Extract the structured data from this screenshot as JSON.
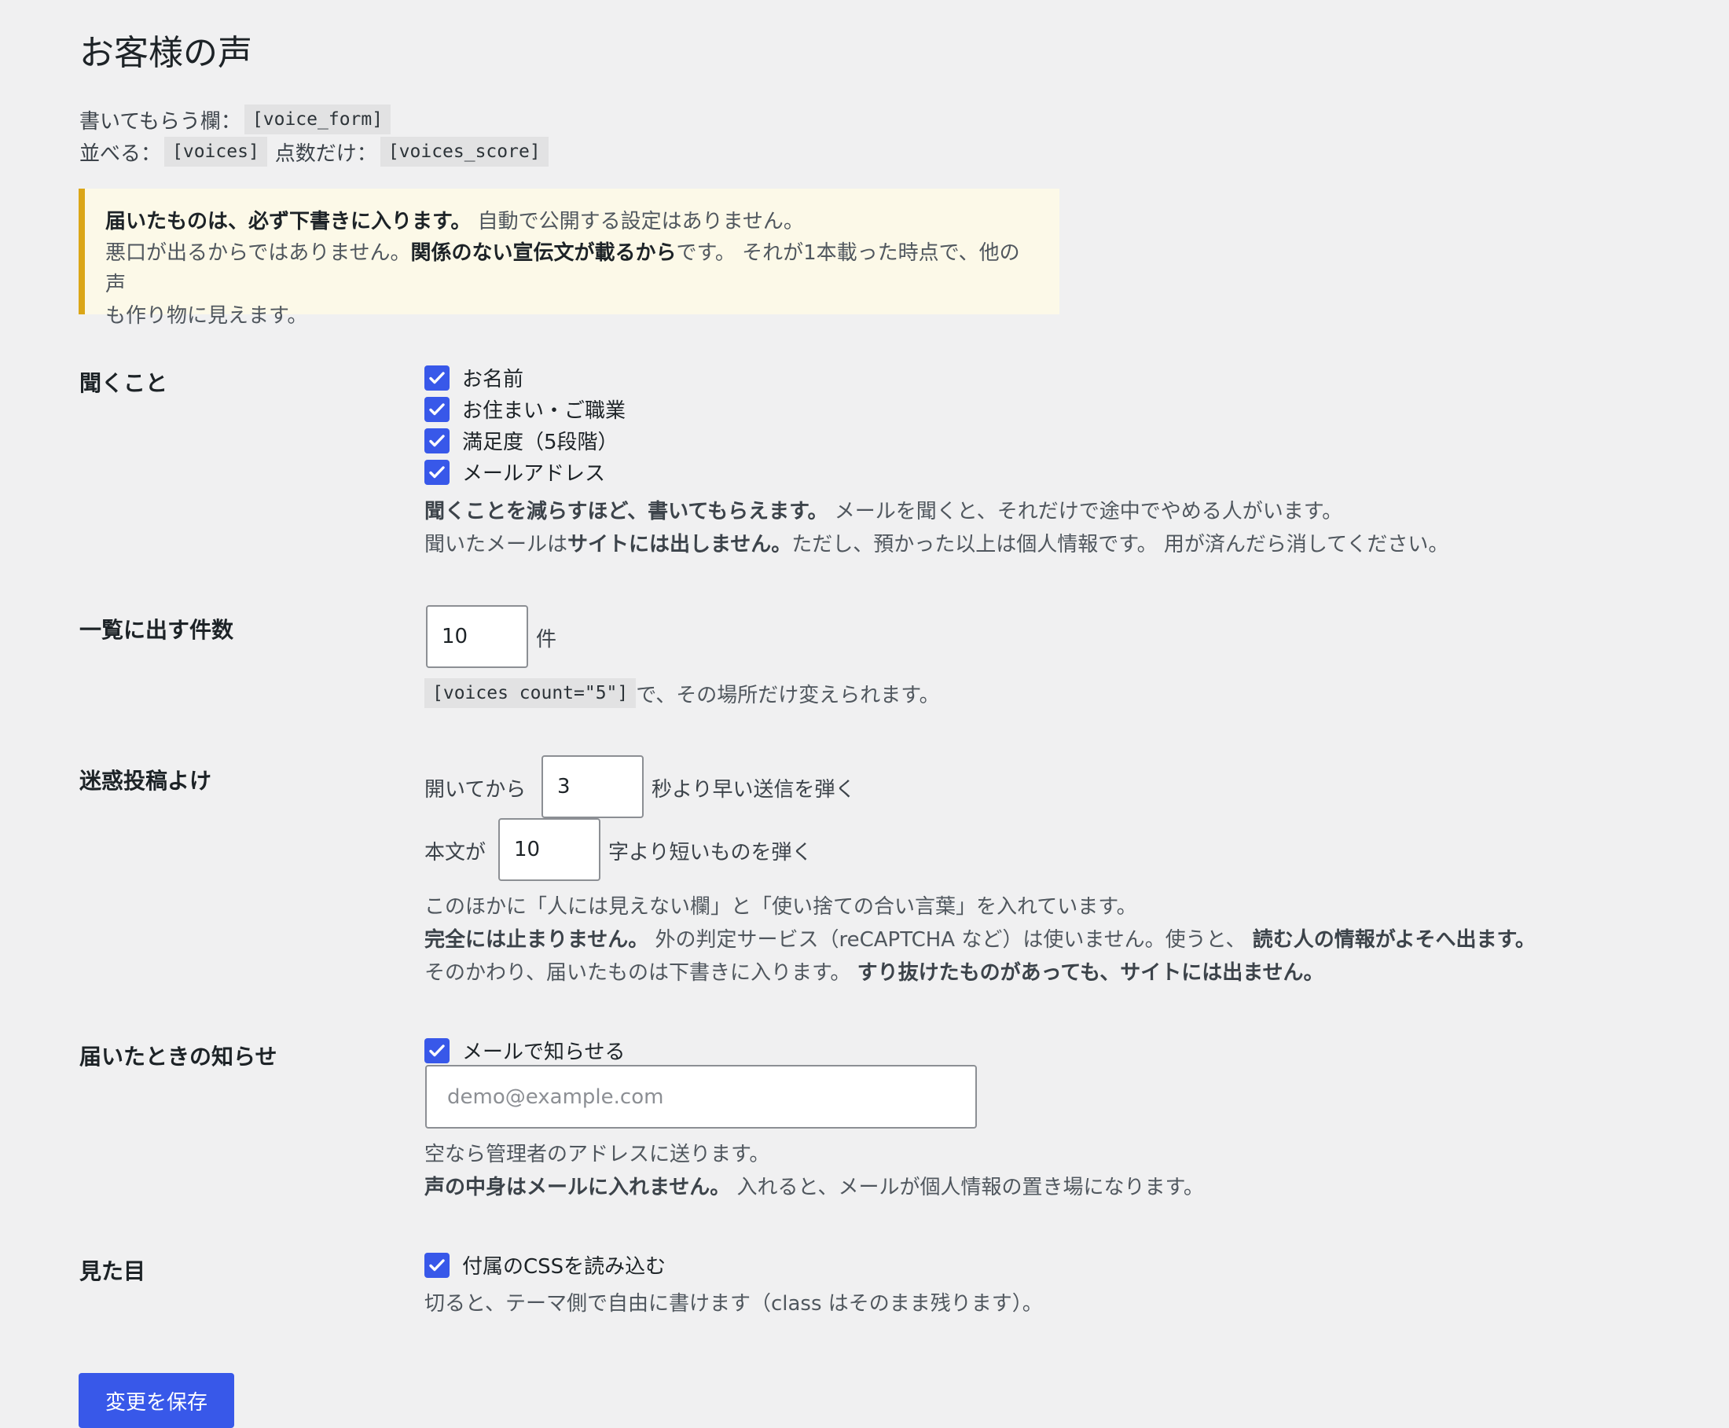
{
  "page": {
    "title": "お客様の声"
  },
  "shortcodes": {
    "form_label": "書いてもらう欄：",
    "form_code": "[voice_form]",
    "list_label": "並べる：",
    "list_code": "[voices]",
    "score_label": "点数だけ：",
    "score_code": "[voices_score]"
  },
  "notice": {
    "line1_bold": "届いたものは、必ず下書きに入ります。",
    "line1_rest": " 自動で公開する設定はありません。",
    "line2_a": "悪口が出るからではありません。",
    "line2_bold": "関係のない宣伝文が載るから",
    "line2_b": "です。 それが1本載った時点で、他の声",
    "line3": "も作り物に見えます。"
  },
  "fields_section": {
    "label": "聞くこと",
    "options": [
      {
        "label": "お名前",
        "checked": true
      },
      {
        "label": "お住まい・ご職業",
        "checked": true
      },
      {
        "label": "満足度（5段階）",
        "checked": true
      },
      {
        "label": "メールアドレス",
        "checked": true
      }
    ],
    "desc1_bold": "聞くことを減らすほど、書いてもらえます。",
    "desc1_rest": " メールを聞くと、それだけで途中でやめる人がいます。",
    "desc2_a": "聞いたメールは",
    "desc2_bold": "サイトには出しません。",
    "desc2_b": "ただし、預かった以上は個人情報です。 用が済んだら消してください。"
  },
  "count_section": {
    "label": "一覧に出す件数",
    "value": "10",
    "unit": "件",
    "hint_code": "[voices count=\"5\"]",
    "hint_text": " で、その場所だけ変えられます。"
  },
  "spam_section": {
    "label": "迷惑投稿よけ",
    "time_prefix": "開いてから",
    "time_value": "3",
    "time_suffix": "秒より早い送信を弾く",
    "length_prefix": "本文が",
    "length_value": "10",
    "length_suffix": "字より短いものを弾く",
    "desc1": "このほかに「人には見えない欄」と「使い捨ての合い言葉」を入れています。",
    "desc2_bold": "完全には止まりません。",
    "desc2_mid": " 外の判定サービス（reCAPTCHA など）は使いません。使うと、 ",
    "desc2_bold2": "読む人の情報がよそへ出ます。",
    "desc3_a": "そのかわり、届いたものは下書きに入ります。 ",
    "desc3_bold": "すり抜けたものがあっても、サイトには出ません。"
  },
  "notify_section": {
    "label": "届いたときの知らせ",
    "checkbox_label": "メールで知らせる",
    "checked": true,
    "email_placeholder": "demo@example.com",
    "desc1": "空なら管理者のアドレスに送ります。",
    "desc2_bold": "声の中身はメールに入れません。",
    "desc2_rest": " 入れると、メールが個人情報の置き場になります。"
  },
  "appearance_section": {
    "label": "見た目",
    "checkbox_label": "付属のCSSを読み込む",
    "checked": true,
    "desc": "切ると、テーマ側で自由に書けます（class はそのまま残ります）。"
  },
  "save_button": {
    "label": "変更を保存"
  },
  "colors": {
    "accent": "#3858e9",
    "notice_border": "#dba617",
    "notice_bg": "#fcf9e8"
  }
}
